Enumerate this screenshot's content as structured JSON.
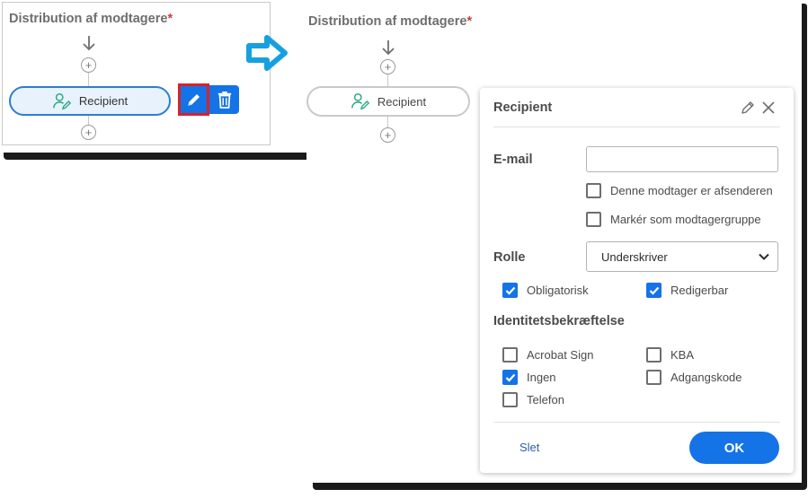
{
  "left_panel": {
    "title": "Distribution af modtagere",
    "required_marker": "*",
    "recipient_node": "Recipient",
    "edit_button_highlight_color": "#d7222a"
  },
  "right_panel": {
    "title": "Distribution af modtagere",
    "required_marker": "*",
    "recipient_node": "Recipient"
  },
  "recipient_dialog": {
    "title": "Recipient",
    "email_label": "E-mail",
    "email_value": "",
    "sender_checkbox": {
      "label": "Denne modtager er afsenderen",
      "checked": false
    },
    "group_checkbox": {
      "label": "Markér som modtagergruppe",
      "checked": false
    },
    "role_label": "Rolle",
    "role_value": "Underskriver",
    "required_checkbox": {
      "label": "Obligatorisk",
      "checked": true
    },
    "editable_checkbox": {
      "label": "Redigerbar",
      "checked": true
    },
    "identity_label": "Identitetsbekræftelse",
    "identity_options": [
      {
        "label": "Acrobat Sign",
        "checked": false
      },
      {
        "label": "KBA",
        "checked": false
      },
      {
        "label": "Ingen",
        "checked": true
      },
      {
        "label": "Adgangskode",
        "checked": false
      },
      {
        "label": "Telefon",
        "checked": false
      }
    ],
    "delete_label": "Slet",
    "ok_label": "OK"
  },
  "colors": {
    "accent": "#1473e6",
    "required": "#d7373f",
    "node_icon": "#2aa980"
  },
  "icons": [
    "arrow-down-icon",
    "plus-circle-icon",
    "recipient-signer-icon",
    "pencil-icon",
    "trash-icon",
    "right-arrow-icon",
    "close-icon",
    "chevron-down-icon",
    "checkmark-icon"
  ]
}
